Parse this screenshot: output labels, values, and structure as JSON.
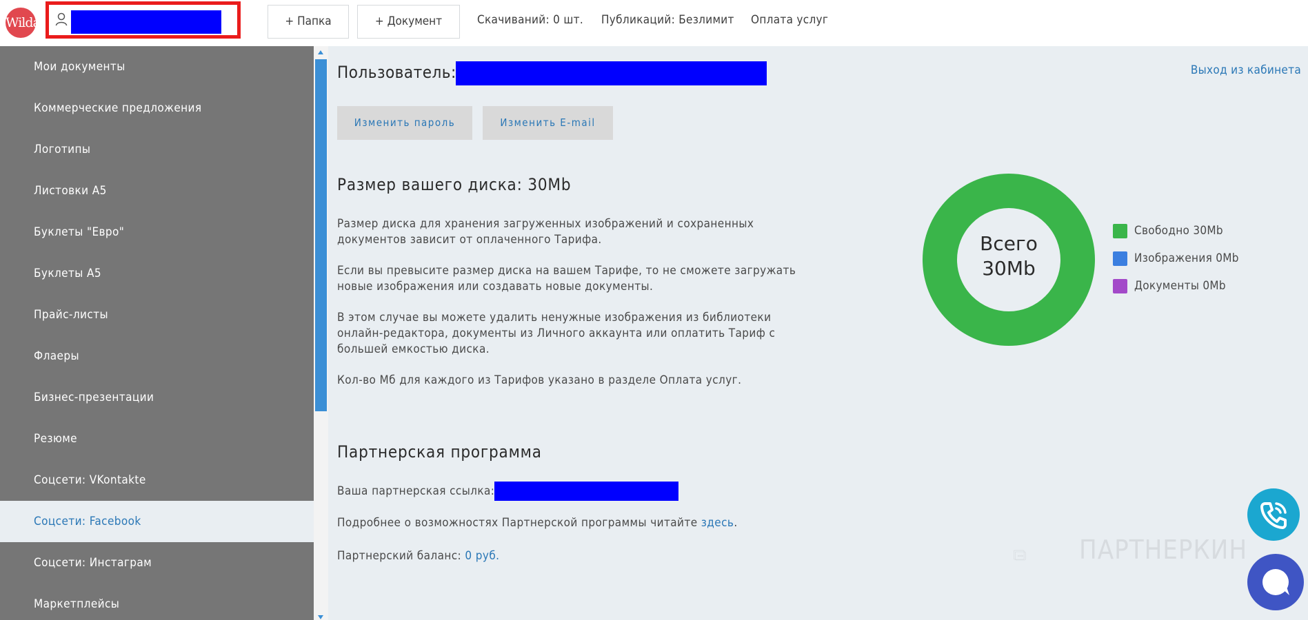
{
  "header": {
    "logo_text": "Wilda",
    "folder_button": "+ Папка",
    "document_button": "+ Документ",
    "downloads": "Скачиваний: 0 шт.",
    "publications": "Публикаций: Безлимит",
    "payment": "Оплата услуг"
  },
  "sidebar": {
    "items": [
      {
        "label": "Мои документы"
      },
      {
        "label": "Коммерческие предложения"
      },
      {
        "label": "Логотипы"
      },
      {
        "label": "Листовки А5"
      },
      {
        "label": "Буклеты \"Евро\""
      },
      {
        "label": "Буклеты А5"
      },
      {
        "label": "Прайс-листы"
      },
      {
        "label": "Флаеры"
      },
      {
        "label": "Бизнес-презентации"
      },
      {
        "label": "Резюме"
      },
      {
        "label": "Соцсети: VKontakte"
      },
      {
        "label": "Соцсети: Facebook",
        "active": true
      },
      {
        "label": "Соцсети: Инстаграм"
      },
      {
        "label": "Маркетплейсы"
      }
    ]
  },
  "account": {
    "user_label": "Пользователь:",
    "logout": "Выход из кабинета",
    "change_password": "Изменить пароль",
    "change_email": "Изменить E-mail"
  },
  "disk": {
    "title": "Размер вашего диска: 30Mb",
    "p1": "Размер диска для хранения загруженных изображений и сохраненных документов зависит от оплаченного Тарифа.",
    "p2": "Если вы превысите размер диска на вашем Тарифе, то не сможете загружать новые изображения или создавать новые документы.",
    "p3": "В этом случае вы можете удалить ненужные изображения из библиотеки онлайн-редактора, документы из Личного аккаунта или оплатить Тариф с большей емкостью диска.",
    "p4": "Кол-во Мб для каждого из Тарифов указано в разделе Оплата услуг.",
    "donut_total_line1": "Всего",
    "donut_total_line2": "30Mb",
    "legend": [
      {
        "label": "Свободно 30Mb",
        "color": "#3ab54a",
        "value": 30
      },
      {
        "label": "Изображения 0Mb",
        "color": "#3b7fe0",
        "value": 0
      },
      {
        "label": "Документы 0Mb",
        "color": "#a349c9",
        "value": 0
      }
    ]
  },
  "partner": {
    "title": "Партнерская программа",
    "link_label": "Ваша партнерская ссылка:",
    "more_text": "Подробнее о возможностях Партнерской программы читайте ",
    "more_link": "здесь",
    "more_end": ".",
    "balance_label": "Партнерский баланс: ",
    "balance_value": "0 руб."
  },
  "watermark": {
    "text": "ПАРТНЕРКИН"
  },
  "colors": {
    "accent": "#2a77b6",
    "sidebar_bg": "#767676",
    "donut_free": "#3ab54a",
    "phone_fab": "#1ba7d0",
    "chat_fab": "#3f55c4"
  }
}
